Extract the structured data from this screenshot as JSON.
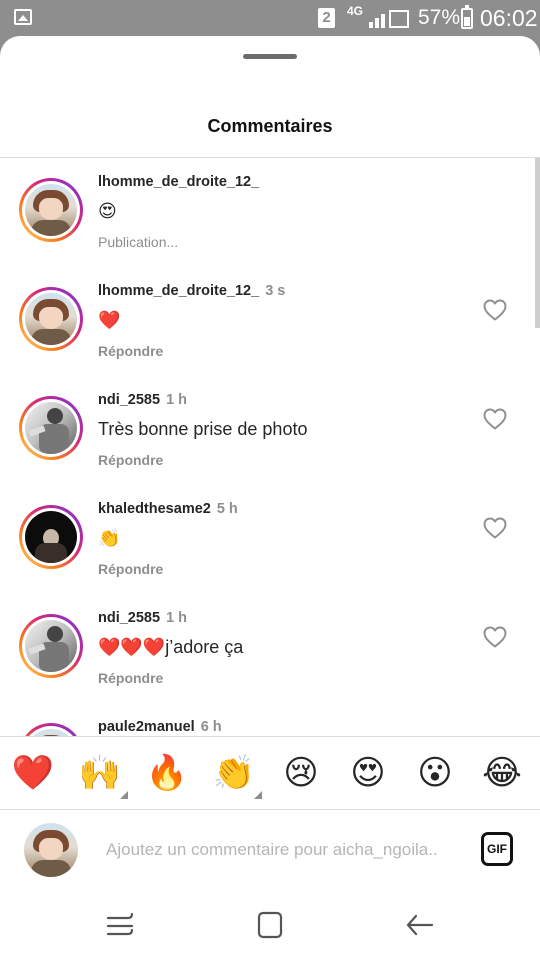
{
  "status_bar": {
    "sim": "2",
    "network": "4G",
    "battery": "57%",
    "time": "06:02",
    "icons": [
      "image-icon",
      "sim-icon",
      "signal-icon",
      "battery-icon"
    ]
  },
  "sheet": {
    "title": "Commentaires"
  },
  "comments": [
    {
      "username": "lhomme_de_droite_12_",
      "time": "",
      "text": "😍",
      "action": "Publication...",
      "avatar": "anime",
      "liked": false,
      "pending": true
    },
    {
      "username": "lhomme_de_droite_12_",
      "time": "3 s",
      "text": "❤️",
      "action": "Répondre",
      "avatar": "anime",
      "liked": false,
      "pending": false
    },
    {
      "username": "ndi_2585",
      "time": "1 h",
      "text": "Très bonne prise de photo",
      "action": "Répondre",
      "avatar": "bw",
      "liked": false,
      "pending": false
    },
    {
      "username": "khaledthesame2",
      "time": "5 h",
      "text": "👏",
      "action": "Répondre",
      "avatar": "dark",
      "liked": false,
      "pending": false
    },
    {
      "username": "ndi_2585",
      "time": "1 h",
      "text": "❤️❤️❤️j’adore ça",
      "action": "Répondre",
      "avatar": "bw",
      "liked": false,
      "pending": false
    },
    {
      "username": "paule2manuel",
      "time": "6 h",
      "text": "",
      "action": "",
      "avatar": "anime",
      "liked": false,
      "pending": false
    }
  ],
  "quick_emojis": [
    "❤️",
    "🙌",
    "🔥",
    "👏",
    "😢",
    "😍",
    "😮",
    "😂"
  ],
  "composer": {
    "placeholder": "Ajoutez un commentaire pour aicha_ngoila..",
    "gif_label": "GIF"
  },
  "nav": {
    "buttons": [
      "recent-apps-icon",
      "home-icon",
      "back-icon"
    ]
  },
  "colors": {
    "primary_text": "#262626",
    "secondary_text": "#8e8e8e",
    "divider": "#dbdbdb",
    "status_bar": "#8e8e8e"
  }
}
